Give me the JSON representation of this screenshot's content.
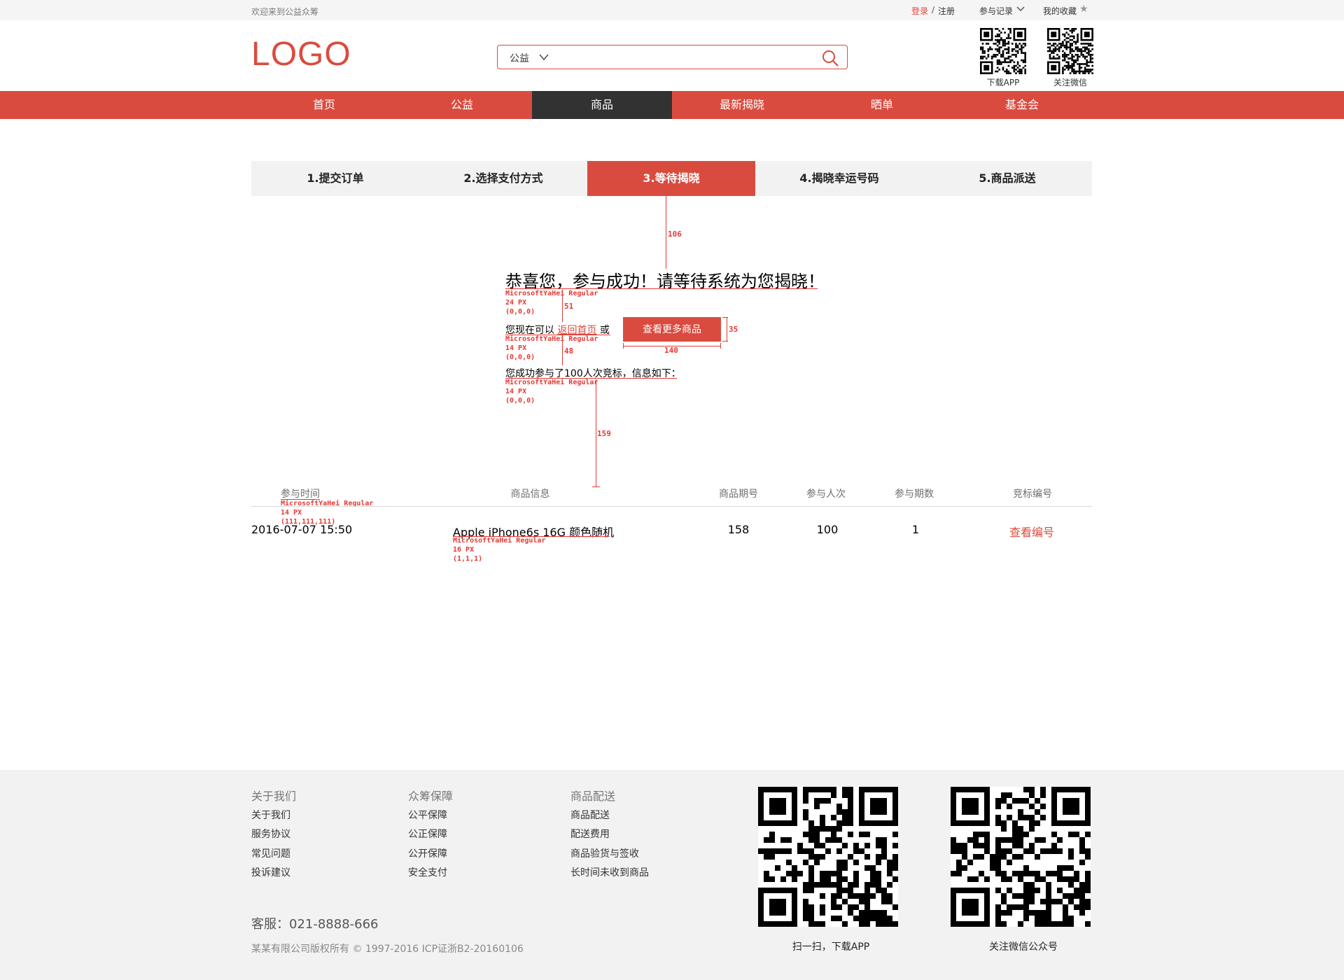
{
  "topbar": {
    "welcome": "欢迎来到公益众筹",
    "login": "登录",
    "separator": "/",
    "register": "注册",
    "records": "参与记录",
    "favorites": "我的收藏"
  },
  "header": {
    "logo": "LOGO",
    "search": {
      "category": "公益",
      "placeholder": ""
    },
    "qr_codes": [
      {
        "label": "下载APP"
      },
      {
        "label": "关注微信"
      }
    ]
  },
  "nav": {
    "items": [
      "首页",
      "公益",
      "商品",
      "最新揭晓",
      "晒单",
      "基金会"
    ],
    "active_index": 2
  },
  "steps": {
    "items": [
      "1.提交订单",
      "2.选择支付方式",
      "3.等待揭晓",
      "4.揭晓幸运号码",
      "5.商品派送"
    ],
    "active_index": 2
  },
  "success": {
    "headline": "恭喜您，参与成功！请等待系统为您揭晓！",
    "prefix": "您现在可以",
    "back_link": "返回首页",
    "suffix": "或",
    "more_button": "查看更多商品",
    "summary": "您成功参与了100人次竞标，信息如下："
  },
  "annotations": {
    "headline_spec": [
      "MicrosoftYaHei Regular",
      "24 PX",
      "(0,0,0)"
    ],
    "line2_spec": [
      "MicrosoftYaHei Regular",
      "14 PX",
      "(0,0,0)"
    ],
    "line3_spec": [
      "MicrosoftYaHei Regular",
      "14 PX",
      "(0,0,0)"
    ],
    "th_spec": [
      "MicrosoftYaHei Regular",
      "14 PX",
      "(111,111,111)"
    ],
    "td_spec": [
      "MicrosoftYaHei Regular",
      "16 PX",
      "(1,1,1)"
    ],
    "dims": {
      "d106": "106",
      "d51": "51",
      "d48": "48",
      "d35": "35",
      "d140": "140",
      "d159": "159"
    }
  },
  "table": {
    "headers": [
      "参与时间",
      "商品信息",
      "商品期号",
      "参与人次",
      "参与期数",
      "竞标编号"
    ],
    "rows": [
      {
        "time": "2016-07-07    15:50",
        "product": "Apple iPhone6s 16G 颜色随机",
        "period": "158",
        "participations": "100",
        "periods": "1",
        "action": "查看编号"
      }
    ]
  },
  "footer": {
    "columns": [
      {
        "title": "关于我们",
        "links": [
          "关于我们",
          "服务协议",
          "常见问题",
          "投诉建议"
        ]
      },
      {
        "title": "众筹保障",
        "links": [
          "公平保障",
          "公正保障",
          "公开保障",
          "安全支付"
        ]
      },
      {
        "title": "商品配送",
        "links": [
          "商品配送",
          "配送费用",
          "商品验货与签收",
          "长时间未收到商品"
        ]
      }
    ],
    "service": "客服：021-8888-666",
    "copyright": "某某有限公司版权所有 © 1997-2016 ICP证浙B2-20160106",
    "qr_codes": [
      {
        "label": "扫一扫，下载APP"
      },
      {
        "label": "关注微信公众号"
      }
    ]
  },
  "colors": {
    "accent": "#da4b3f",
    "nav_active": "#323232",
    "annotation": "#e53935"
  }
}
